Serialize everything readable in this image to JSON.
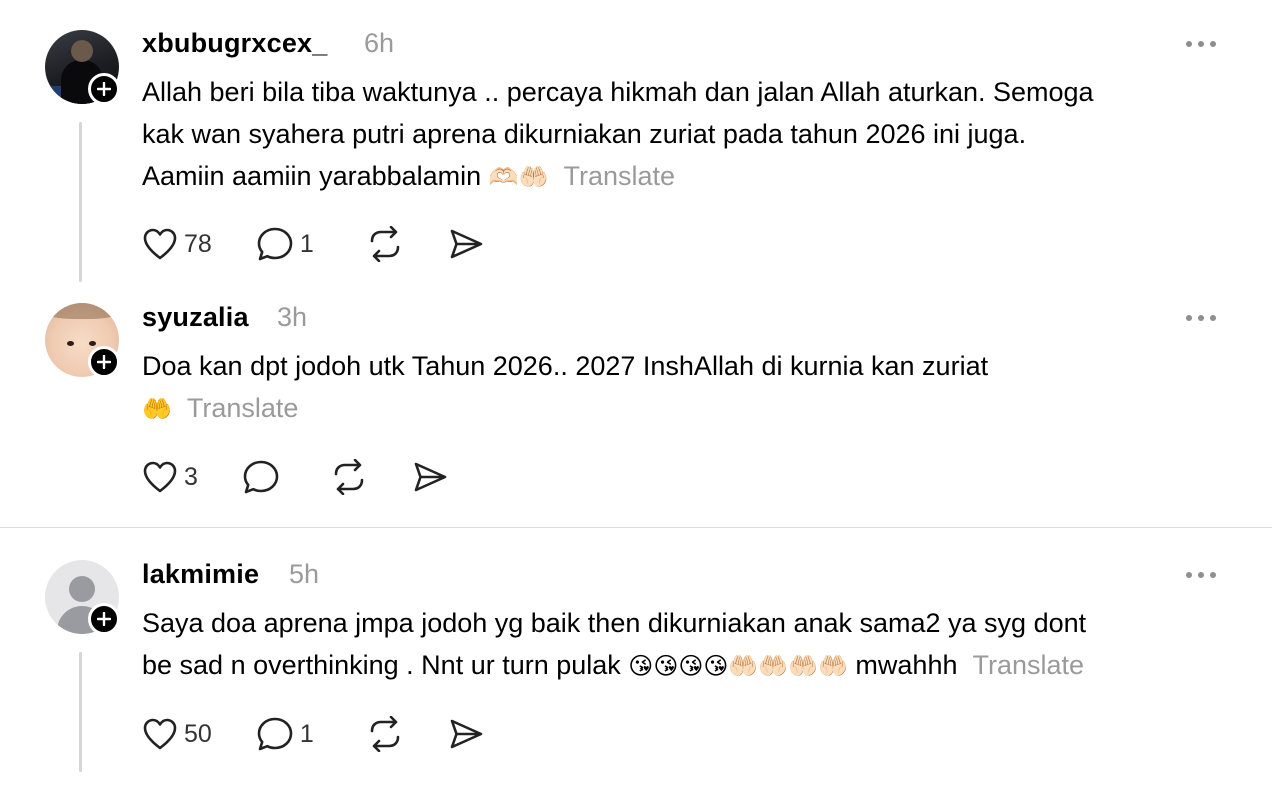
{
  "posts": [
    {
      "username": "xbubugrxcex_",
      "time": "6h",
      "text_lines": [
        "Allah beri bila tiba waktunya .. percaya hikmah dan jalan Allah aturkan. Semoga",
        "kak wan syahera putri aprena dikurniakan zuriat pada tahun 2026 ini juga.",
        "Aamiin aamiin yarabbalamin"
      ],
      "emoji": "🫶🏻🤲🏻",
      "translate": "Translate",
      "likes": "78",
      "replies": "1"
    },
    {
      "username": "syuzalia",
      "time": "3h",
      "text_lines": [
        "Doa kan dpt jodoh utk Tahun 2026.. 2027 InshAllah di kurnia kan zuriat"
      ],
      "emoji": "🤲",
      "translate": "Translate",
      "likes": "3",
      "replies": ""
    },
    {
      "username": "lakmimie",
      "time": "5h",
      "text_lines": [
        "Saya doa aprena jmpa jodoh yg baik then dikurniakan anak sama2 ya syg dont",
        "be sad n overthinking . Nnt ur turn pulak"
      ],
      "emoji": "😘😘😘😘🤲🏻🤲🏻🤲🏻🤲🏻",
      "emoji_suffix": "mwahhh",
      "translate": "Translate",
      "likes": "50",
      "replies": "1"
    }
  ],
  "icons": {
    "like": "heart-icon",
    "reply": "comment-icon",
    "repost": "repost-icon",
    "share": "send-icon",
    "more": "more-options-icon",
    "follow": "plus-icon"
  }
}
